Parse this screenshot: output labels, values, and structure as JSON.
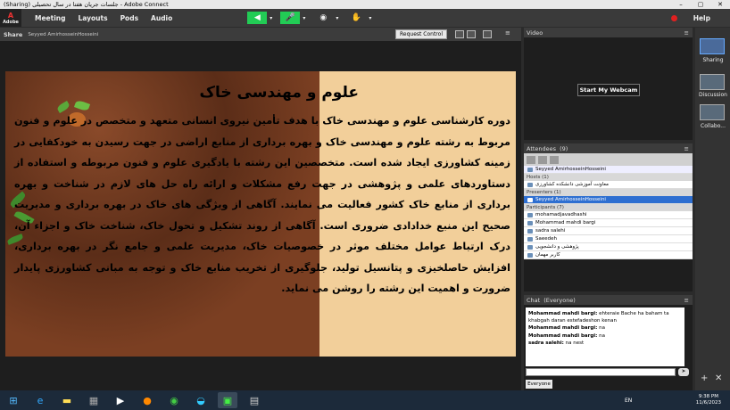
{
  "window": {
    "title": "(Sharing) جلسات جریان هفتا در سال تحصیلی - Adobe Connect",
    "min": "–",
    "max": "▢",
    "close": "✕"
  },
  "menubar": {
    "logo": "Adobe",
    "items": [
      "Meeting",
      "Layouts",
      "Pods",
      "Audio"
    ],
    "help": "Help"
  },
  "share": {
    "title": "Share",
    "presenter": "Seyyed AmirhosseinHosseini",
    "request_control": "Request Control"
  },
  "slide": {
    "title": "علوم و مهندسی خاک",
    "body": "دوره کارشناسی علوم و مهندسی خاک با هدف تأمین نیروی انسانی متعهد و متخصص در علوم و فنون مربوط به رشته علوم و مهندسی خاک و بهره برداری از منابع اراضی در جهت رسیدن به خودکفایی در زمینه کشاورزی ایجاد شده است. متخصصین این رشته با یادگیری علوم و فنون مربوطه و استفاده از دستاوردهای علمی و پژوهشی در جهت رفع مشکلات و ارائه راه حل های لازم در شناخت و بهره برداری از منابع خاک کشور فعالیت می نمایند. آگاهی از ویژگی های خاک در بهره برداری و مدیریت صحیح این منبع خدادادی ضروری است. آگاهی از روند تشکیل و تحول خاک، شناخت خاک و اجزاء آن، درک ارتباط عوامل مختلف موثر در خصوصیات خاک، مدیریت علمی و جامع نگر در بهره برداری، افزایش حاصلخیزی و پتانسیل تولید، جلوگیری از تخریب منابع خاک و توجه به مبانی کشاورزی پایدار ضرورت و اهمیت این رشته را روشن می نماید."
  },
  "video": {
    "title": "Video",
    "webcam_button": "Start My Webcam"
  },
  "attendees": {
    "title": "Attendees",
    "count": "(9)",
    "logged_user": "Seyyed AmirhosseinHosseini",
    "hosts_label": "Hosts (1)",
    "hosts": [
      "معاونت آموزشی دانشکده کشاورزی"
    ],
    "presenters_label": "Presenters (1)",
    "presenters": [
      "Seyyed AmirhosseinHosseini"
    ],
    "participants_label": "Participants (7)",
    "participants": [
      "mohamadjavadhashi",
      "Mohammad mahdi bargi",
      "sadra salehi",
      "Saeedeh",
      "پژوهشی و دانشجویی",
      "کاربر مهمان"
    ]
  },
  "chat": {
    "title": "Chat",
    "scope": "(Everyone)",
    "messages": [
      {
        "sender": "Mohammad mahdi bargi:",
        "text": "ehteraie Bache ha baham ta khabgah daran estefadeshon kenan"
      },
      {
        "sender": "Mohammad mahdi bargi:",
        "text": "na"
      },
      {
        "sender": "Mohammad mahdi bargi:",
        "text": "na"
      },
      {
        "sender": "sadra salehi:",
        "text": "na nest"
      }
    ],
    "tab": "Everyone"
  },
  "layouts": {
    "items": [
      "Sharing",
      "Discussion",
      "Collabo..."
    ]
  },
  "taskbar": {
    "lang": "EN",
    "time": "9:38 PM",
    "date": "11/6/2023"
  },
  "colors": {
    "slide_beige": "#f2cf9a",
    "presenter_highlight": "#2e6fd1",
    "record_dot": "#e02020"
  }
}
